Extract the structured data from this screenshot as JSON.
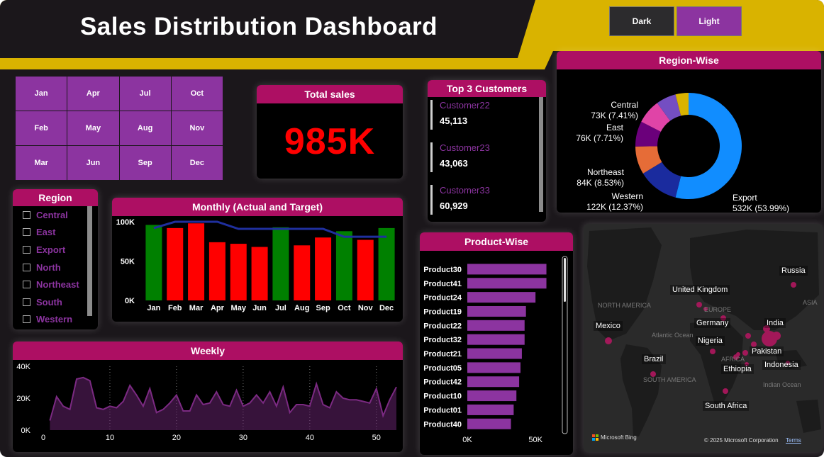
{
  "header": {
    "title": "Sales Distribution Dashboard"
  },
  "theme": {
    "dark_label": "Dark",
    "light_label": "Light"
  },
  "months": [
    "Jan",
    "Apr",
    "Jul",
    "Oct",
    "Feb",
    "May",
    "Aug",
    "Nov",
    "Mar",
    "Jun",
    "Sep",
    "Dec"
  ],
  "total_sales": {
    "title": "Total sales",
    "value": "985K"
  },
  "top_customers": {
    "title": "Top 3 Customers",
    "items": [
      {
        "name": "Customer22",
        "value": "45,113"
      },
      {
        "name": "Customer23",
        "value": "43,063"
      },
      {
        "name": "Customer33",
        "value": "60,929"
      }
    ]
  },
  "region_filter": {
    "title": "Region",
    "items": [
      "Central",
      "East",
      "Export",
      "North",
      "Northeast",
      "South",
      "Western"
    ]
  },
  "monthly": {
    "title": "Monthly (Actual and Target)",
    "chart_data": {
      "type": "bar",
      "categories": [
        "Jan",
        "Feb",
        "Mar",
        "Apr",
        "May",
        "Jun",
        "Jul",
        "Aug",
        "Sep",
        "Oct",
        "Nov",
        "Dec"
      ],
      "series": [
        {
          "values": [
            96,
            92,
            98,
            74,
            72,
            68,
            93,
            70,
            80,
            88,
            77,
            92
          ],
          "colors": [
            "#008000",
            "#ff0000",
            "#ff0000",
            "#ff0000",
            "#ff0000",
            "#ff0000",
            "#008000",
            "#ff0000",
            "#ff0000",
            "#008000",
            "#ff0000",
            "#008000"
          ]
        },
        {
          "values": [
            92,
            100,
            100,
            100,
            91,
            91,
            91,
            91,
            91,
            81,
            81,
            81
          ],
          "color": "#1f2f9e"
        }
      ],
      "yticks": [
        "0K",
        "50K",
        "100K"
      ],
      "ylim": [
        0,
        100
      ]
    }
  },
  "weekly": {
    "title": "Weekly",
    "chart_data": {
      "type": "area",
      "x": [
        1,
        2,
        3,
        4,
        5,
        6,
        7,
        8,
        9,
        10,
        11,
        12,
        13,
        14,
        15,
        16,
        17,
        18,
        19,
        20,
        21,
        22,
        23,
        24,
        25,
        26,
        27,
        28,
        29,
        30,
        31,
        32,
        33,
        34,
        35,
        36,
        37,
        38,
        39,
        40,
        41,
        42,
        43,
        44,
        45,
        46,
        47,
        48,
        49,
        50,
        51,
        52,
        53
      ],
      "values": [
        6,
        21,
        15,
        13,
        32,
        33,
        31,
        14,
        13,
        15,
        14,
        18,
        28,
        22,
        15,
        26,
        11,
        13,
        17,
        22,
        12,
        12,
        22,
        16,
        17,
        24,
        16,
        15,
        25,
        15,
        17,
        22,
        17,
        24,
        15,
        27,
        11,
        16,
        16,
        15,
        29,
        16,
        14,
        24,
        20,
        19,
        19,
        18,
        17,
        26,
        9,
        19,
        27
      ],
      "xticks": [
        "0",
        "10",
        "20",
        "30",
        "40",
        "50"
      ],
      "yticks": [
        "0K",
        "20K",
        "40K"
      ],
      "ylim": [
        0,
        40
      ],
      "color": "#7b2a82"
    }
  },
  "region_wise": {
    "title": "Region-Wise",
    "chart_data": {
      "type": "pie",
      "slices": [
        {
          "name": "Export",
          "value": 532,
          "label": "532K (53.99%)",
          "color": "#118dff"
        },
        {
          "name": "Western",
          "value": 122,
          "label": "122K (12.37%)",
          "color": "#1a2b9e"
        },
        {
          "name": "Northeast",
          "value": 84,
          "label": "84K (8.53%)",
          "color": "#e66c37"
        },
        {
          "name": "East",
          "value": 76,
          "label": "76K (7.71%)",
          "color": "#6b007b"
        },
        {
          "name": "Central",
          "value": 73,
          "label": "73K (7.41%)",
          "color": "#e044a7"
        },
        {
          "name": "",
          "value": 60,
          "label": "",
          "color": "#744ec2"
        },
        {
          "name": "",
          "value": 39,
          "label": "",
          "color": "#d9b300"
        }
      ]
    }
  },
  "product_wise": {
    "title": "Product-Wise",
    "chart_data": {
      "type": "bar",
      "orientation": "horizontal",
      "categories": [
        "Product30",
        "Product41",
        "Product24",
        "Product19",
        "Product22",
        "Product32",
        "Product21",
        "Product05",
        "Product42",
        "Product10",
        "Product01",
        "Product40"
      ],
      "values": [
        58,
        58,
        50,
        43,
        42,
        42,
        40,
        39,
        38,
        36,
        34,
        32
      ],
      "xticks": [
        "0K",
        "50K"
      ],
      "xlim": [
        0,
        65
      ],
      "color": "#8c34a0"
    }
  },
  "map": {
    "countries": [
      "Russia",
      "United Kingdom",
      "Mexico",
      "Germany",
      "India",
      "Nigeria",
      "Pakistan",
      "Brazil",
      "Ethiopia",
      "Indonesia",
      "South Africa"
    ],
    "regions": [
      "NORTH AMERICA",
      "EUROPE",
      "ASIA",
      "Atlantic Ocean",
      "AFRICA",
      "SOUTH AMERICA",
      "Indian Ocean"
    ],
    "brand": "Microsoft Bing",
    "copyright": "© 2025 Microsoft Corporation",
    "terms": "Terms"
  }
}
